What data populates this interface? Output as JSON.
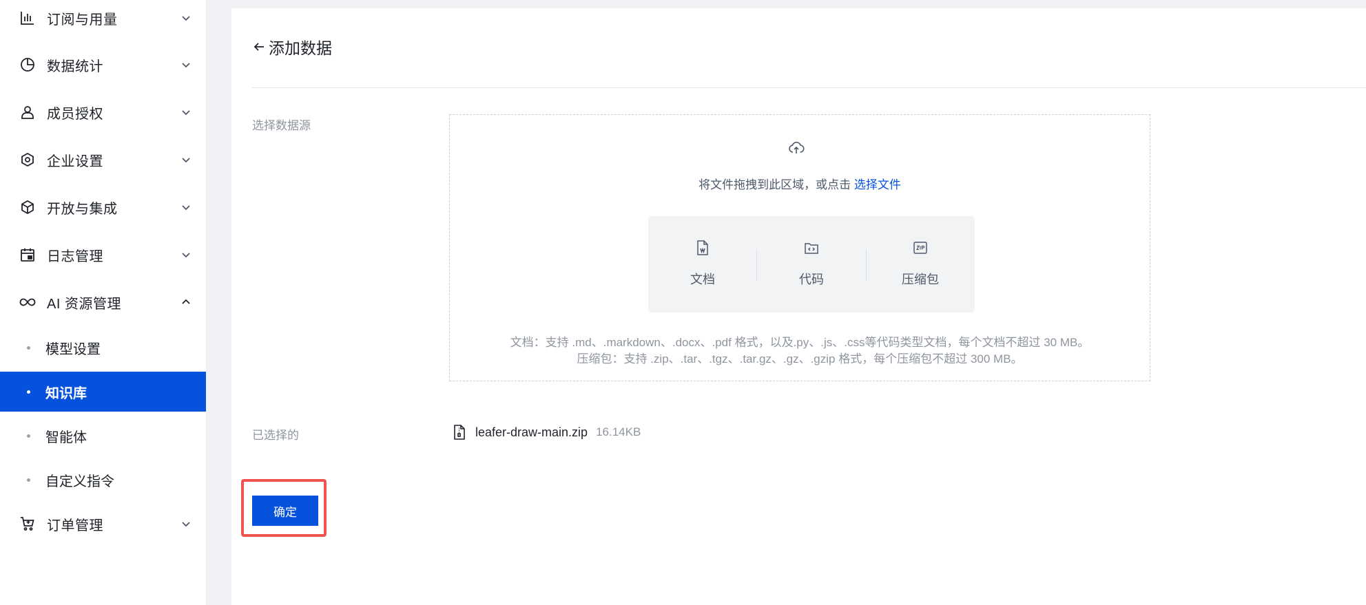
{
  "sidebar": {
    "items": [
      {
        "label": "订阅与用量",
        "icon": "bar-chart-icon",
        "expanded": false
      },
      {
        "label": "数据统计",
        "icon": "pie-chart-icon",
        "expanded": false
      },
      {
        "label": "成员授权",
        "icon": "user-icon",
        "expanded": false
      },
      {
        "label": "企业设置",
        "icon": "settings-hex-icon",
        "expanded": false
      },
      {
        "label": "开放与集成",
        "icon": "cube-icon",
        "expanded": false
      },
      {
        "label": "日志管理",
        "icon": "calendar-log-icon",
        "expanded": false
      },
      {
        "label": "AI 资源管理",
        "icon": "infinity-icon",
        "expanded": true
      },
      {
        "label": "订单管理",
        "icon": "cart-icon",
        "expanded": false
      }
    ],
    "sub_items": [
      {
        "label": "模型设置",
        "active": false
      },
      {
        "label": "知识库",
        "active": true
      },
      {
        "label": "智能体",
        "active": false
      },
      {
        "label": "自定义指令",
        "active": false
      }
    ]
  },
  "main": {
    "title": "添加数据",
    "source_label": "选择数据源",
    "dropzone": {
      "text": "将文件拖拽到此区域，或点击",
      "link": "选择文件",
      "types": [
        {
          "label": "文档",
          "icon": "document-icon"
        },
        {
          "label": "代码",
          "icon": "code-folder-icon"
        },
        {
          "label": "压缩包",
          "icon": "zip-icon"
        }
      ],
      "hint_doc": "文档：支持 .md、.markdown、.docx、.pdf 格式，以及.py、.js、.css等代码类型文档，每个文档不超过 30 MB。",
      "hint_zip": "压缩包：支持 .zip、.tar、.tgz、.tar.gz、.gz、.gzip 格式，每个压缩包不超过 300 MB。"
    },
    "selected_label": "已选择的",
    "selected_file": {
      "name": "leafer-draw-main.zip",
      "size": "16.14KB",
      "icon": "zip-file-icon"
    },
    "confirm_label": "确定"
  },
  "colors": {
    "accent": "#0652dd",
    "highlight_outline": "#ef5350",
    "background": "#f0f2f5"
  }
}
